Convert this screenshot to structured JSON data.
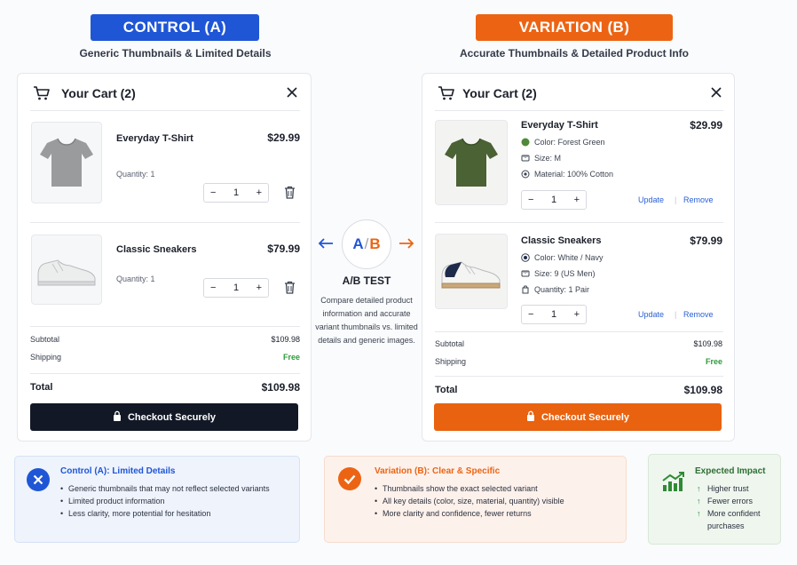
{
  "control": {
    "pill": "CONTROL (A)",
    "subtitle": "Generic Thumbnails & Limited Details",
    "cart_title": "Your Cart (2)",
    "items": [
      {
        "name": "Everyday T-Shirt",
        "price": "$29.99",
        "quantity_text": "Quantity: 1",
        "qty": "1"
      },
      {
        "name": "Classic Sneakers",
        "price": "$79.99",
        "quantity_text": "Quantity: 1",
        "qty": "1"
      }
    ],
    "subtotal_label": "Subtotal",
    "subtotal": "$109.98",
    "shipping_label": "Shipping",
    "shipping": "Free",
    "total_label": "Total",
    "total": "$109.98",
    "checkout": "Checkout Securely"
  },
  "variation": {
    "pill": "VARIATION (B)",
    "subtitle": "Accurate Thumbnails & Detailed Product Info",
    "cart_title": "Your Cart (2)",
    "items": [
      {
        "name": "Everyday T-Shirt",
        "price": "$29.99",
        "color": "Color: Forest Green",
        "size": "Size: M",
        "extra": "Material: 100% Cotton",
        "qty": "1"
      },
      {
        "name": "Classic Sneakers",
        "price": "$79.99",
        "color": "Color: White / Navy",
        "size": "Size: 9 (US Men)",
        "extra": "Quantity: 1 Pair",
        "qty": "1"
      }
    ],
    "update": "Update",
    "remove": "Remove",
    "separator": "|",
    "subtotal_label": "Subtotal",
    "subtotal": "$109.98",
    "shipping_label": "Shipping",
    "shipping": "Free",
    "total_label": "Total",
    "total": "$109.98",
    "checkout": "Checkout Securely"
  },
  "ab": {
    "a": "A",
    "slash": "/",
    "b": "B",
    "title": "A/B TEST",
    "description": "Compare detailed product information and accurate variant thumbnails vs. limited details and generic images."
  },
  "summary_a": {
    "title": "Control (A): Limited Details",
    "bullets": [
      "Generic thumbnails that may not reflect selected variants",
      "Limited product information",
      "Less clarity, more potential for hesitation"
    ]
  },
  "summary_b": {
    "title": "Variation (B): Clear & Specific",
    "bullets": [
      "Thumbnails show the exact selected variant",
      "All key details (color, size, material, quantity) visible",
      "More clarity and confidence, fewer returns"
    ]
  },
  "impact": {
    "title": "Expected Impact",
    "items": [
      "Higher trust",
      "Fewer errors",
      "More confident purchases"
    ]
  },
  "colors": {
    "blue": "#1f56d6",
    "orange": "#ec6413",
    "dark": "#121826",
    "green": "#2f9a3a"
  }
}
